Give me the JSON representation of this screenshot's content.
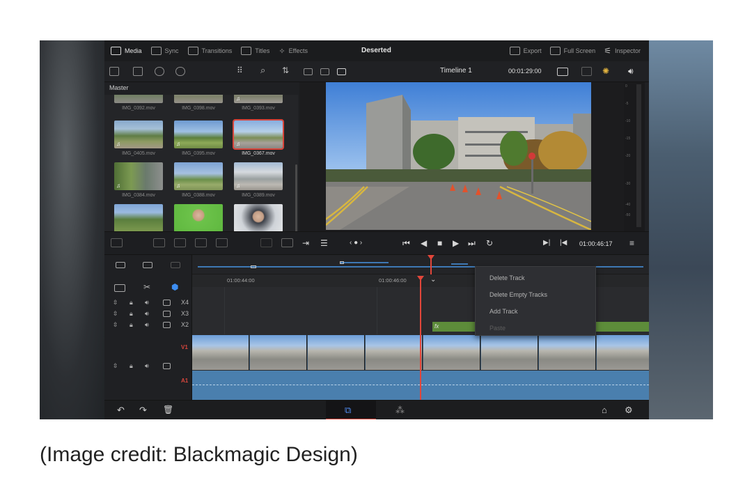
{
  "topbar": {
    "tabs": [
      {
        "label": "Media",
        "icon": "media-icon",
        "active": true
      },
      {
        "label": "Sync",
        "icon": "sync-icon",
        "active": false
      },
      {
        "label": "Transitions",
        "icon": "transitions-icon",
        "active": false
      },
      {
        "label": "Titles",
        "icon": "titles-icon",
        "active": false
      },
      {
        "label": "Effects",
        "icon": "effects-icon",
        "active": false
      }
    ],
    "project_title": "Deserted",
    "actions": [
      {
        "label": "Export",
        "icon": "export-icon"
      },
      {
        "label": "Full Screen",
        "icon": "fullscreen-icon"
      },
      {
        "label": "Inspector",
        "icon": "inspector-icon"
      }
    ]
  },
  "viewer": {
    "timeline_name": "Timeline 1",
    "timecode": "00:01:29:00",
    "current_timecode": "01:00:46:17"
  },
  "media_pool": {
    "folder": "Master",
    "clips": [
      {
        "name": "IMG_0392.mov",
        "selected": false
      },
      {
        "name": "IMG_0398.mov",
        "selected": false
      },
      {
        "name": "IMG_0393.mov",
        "selected": false
      },
      {
        "name": "IMG_0405.mov",
        "selected": false
      },
      {
        "name": "IMG_0395.mov",
        "selected": false
      },
      {
        "name": "IMG_0367.mov",
        "selected": true
      },
      {
        "name": "IMG_0384.mov",
        "selected": false
      },
      {
        "name": "IMG_0388.mov",
        "selected": false
      },
      {
        "name": "IMG_0389.mov",
        "selected": false
      }
    ]
  },
  "timeline": {
    "ruler": [
      "01:00:44:00",
      "01:00:46:00"
    ],
    "tracks": {
      "x4": "X4",
      "x3": "X3",
      "x2": "X2",
      "v1": "V1",
      "a1": "A1"
    }
  },
  "context_menu": {
    "items": [
      {
        "label": "Delete Track",
        "enabled": true
      },
      {
        "label": "Delete Empty Tracks",
        "enabled": true
      },
      {
        "label": "Add Track",
        "enabled": true
      },
      {
        "label": "Paste",
        "enabled": false
      }
    ]
  },
  "meters": {
    "ticks": [
      "0",
      "-5",
      "-10",
      "-15",
      "-20",
      "-30",
      "-40",
      "-50"
    ]
  },
  "colors": {
    "accent": "#d9453b",
    "audio_track": "#4a7fae",
    "panel": "#1f2023"
  },
  "caption": "(Image credit: Blackmagic Design)"
}
